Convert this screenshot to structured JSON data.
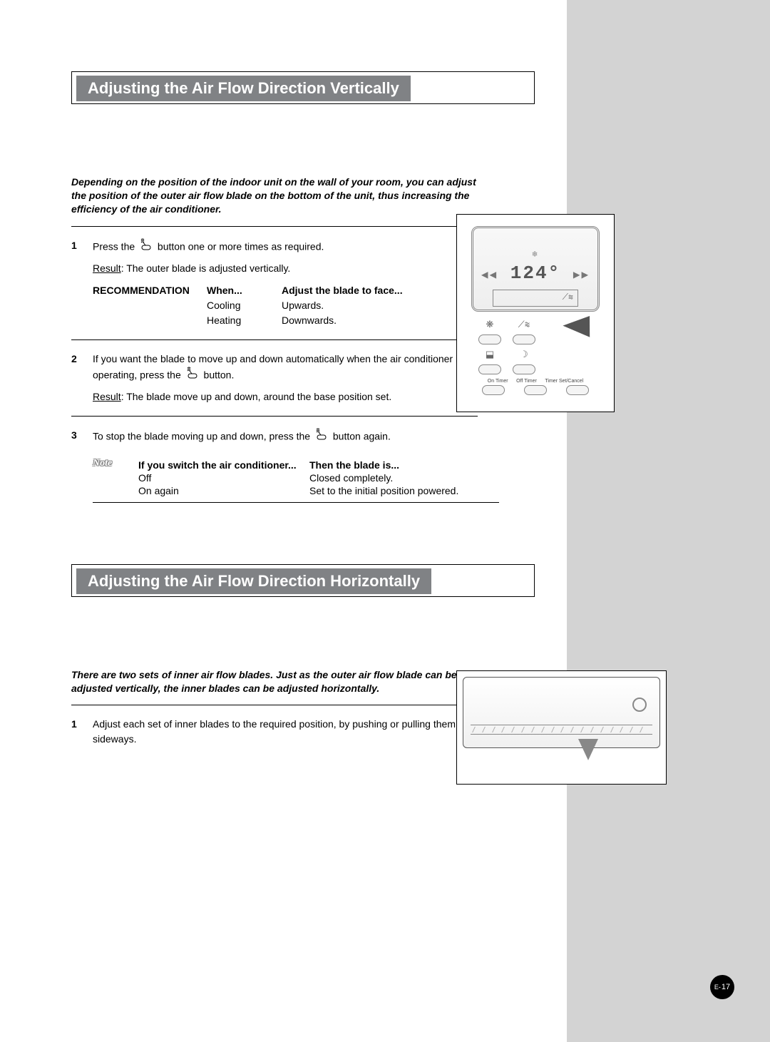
{
  "title1": "Adjusting the Air Flow Direction Vertically",
  "title2": "Adjusting the Air Flow Direction Horizontally",
  "intro1": "Depending on the position of the indoor unit on the wall of your room, you can adjust the position of the outer air flow blade on the bottom of the unit, thus increasing the efficiency of the air conditioner.",
  "intro2": "There are two sets of inner air flow blades. Just as the outer air flow blade can be adjusted vertically, the inner blades can be adjusted horizontally.",
  "step1_num": "1",
  "step1_a": "Press the ",
  "step1_b": " button one or more times as required.",
  "step1_result_label": "Result",
  "step1_result": ":    The outer blade is adjusted vertically.",
  "rec_label": "RECOMMENDATION",
  "rec_h2": "When...",
  "rec_h3": "Adjust the blade to face...",
  "rec_r1c2": "Cooling",
  "rec_r1c3": "Upwards.",
  "rec_r2c2": "Heating",
  "rec_r2c3": "Downwards.",
  "step2_num": "2",
  "step2_a": "If you want the blade to move up and down automatically when the air conditioner is operating, press the ",
  "step2_b": " button.",
  "step2_result_label": "Result",
  "step2_result": ":    The blade move up and down, around the base position set.",
  "step3_num": "3",
  "step3_a": "To stop the blade moving up and down, press the ",
  "step3_b": " button again.",
  "note_label": "Note",
  "note_h1": "If you switch the air conditioner...",
  "note_h2": "Then the blade is...",
  "note_r1c1": "Off",
  "note_r1c2": "Closed completely.",
  "note_r2c1": "On again",
  "note_r2c2": "Set to the initial position powered.",
  "h_step1_num": "1",
  "h_step1": "Adjust each set of inner blades to the required position, by pushing or pulling them sideways.",
  "remote_temp": "124°",
  "remote_labels": {
    "a": "On Timer",
    "b": "Off Timer",
    "c": "Timer Set/Cancel"
  },
  "page_prefix": "E-",
  "page_num": "17"
}
